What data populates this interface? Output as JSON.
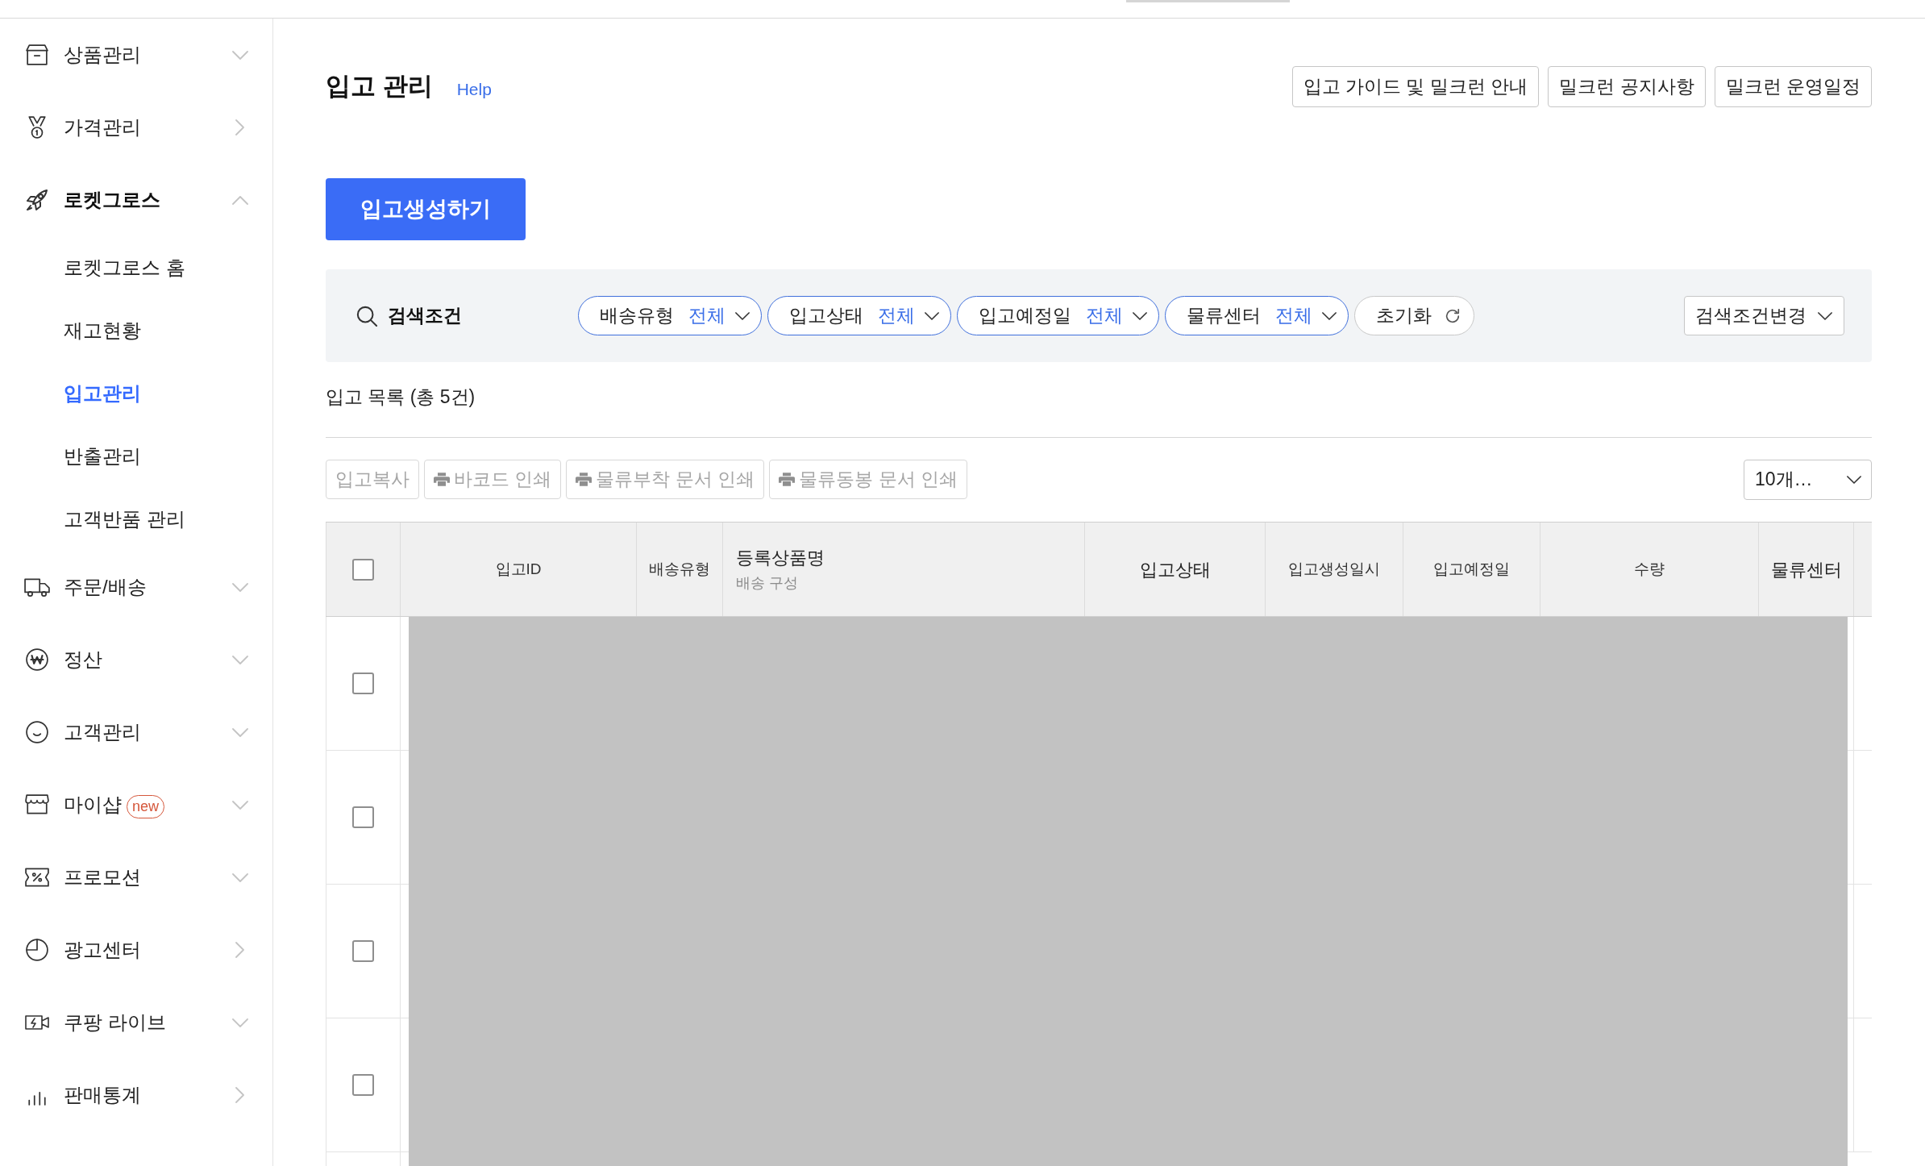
{
  "sidebar": {
    "items": [
      {
        "label": "상품관리",
        "kind": "group",
        "expanded": false
      },
      {
        "label": "가격관리",
        "kind": "link"
      },
      {
        "label": "로켓그로스",
        "kind": "group",
        "expanded": true,
        "children": [
          {
            "label": "로켓그로스 홈",
            "selected": false
          },
          {
            "label": "재고현황",
            "selected": false
          },
          {
            "label": "입고관리",
            "selected": true
          },
          {
            "label": "반출관리",
            "selected": false
          },
          {
            "label": "고객반품 관리",
            "selected": false
          }
        ]
      },
      {
        "label": "주문/배송",
        "kind": "group",
        "expanded": false
      },
      {
        "label": "정산",
        "kind": "group",
        "expanded": false
      },
      {
        "label": "고객관리",
        "kind": "group",
        "expanded": false
      },
      {
        "label": "마이샵",
        "kind": "group",
        "expanded": false,
        "badge": "new"
      },
      {
        "label": "프로모션",
        "kind": "group",
        "expanded": false
      },
      {
        "label": "광고센터",
        "kind": "link"
      },
      {
        "label": "쿠팡 라이브",
        "kind": "group",
        "expanded": false
      },
      {
        "label": "판매통계",
        "kind": "link"
      }
    ]
  },
  "header": {
    "title": "입고 관리",
    "help": "Help",
    "links": [
      "입고 가이드 및 밀크런 안내",
      "밀크런 공지사항",
      "밀크런 운영일정"
    ]
  },
  "create_button": "입고생성하기",
  "search": {
    "label": "검색조건",
    "filters": [
      {
        "label": "배송유형",
        "value": "전체"
      },
      {
        "label": "입고상태",
        "value": "전체"
      },
      {
        "label": "입고예정일",
        "value": "전체"
      },
      {
        "label": "물류센터",
        "value": "전체"
      }
    ],
    "reset": "초기화",
    "change": "검색조건변경"
  },
  "list": {
    "title": "입고 목록 (총 5건)",
    "actions": [
      {
        "label": "입고복사",
        "kind": "plain",
        "disabled": true
      },
      {
        "label": "바코드 인쇄",
        "kind": "print",
        "disabled": true
      },
      {
        "label": "물류부착 문서 인쇄",
        "kind": "print",
        "disabled": true
      },
      {
        "label": "물류동봉 문서 인쇄",
        "kind": "print",
        "disabled": true
      }
    ],
    "page_size": "10개…"
  },
  "table": {
    "select_all": {
      "checked": false
    },
    "columns": [
      {
        "label": "입고ID"
      },
      {
        "label": "배송유형"
      },
      {
        "label": "등록상품명",
        "sublabel": "배송 구성"
      },
      {
        "label": "입고상태"
      },
      {
        "label": "입고생성일시"
      },
      {
        "label": "입고예정일"
      },
      {
        "label": "수량"
      },
      {
        "label": "물류센터"
      }
    ],
    "rows": [
      {
        "checked": false
      },
      {
        "checked": false
      },
      {
        "checked": false
      },
      {
        "checked": false
      }
    ]
  }
}
